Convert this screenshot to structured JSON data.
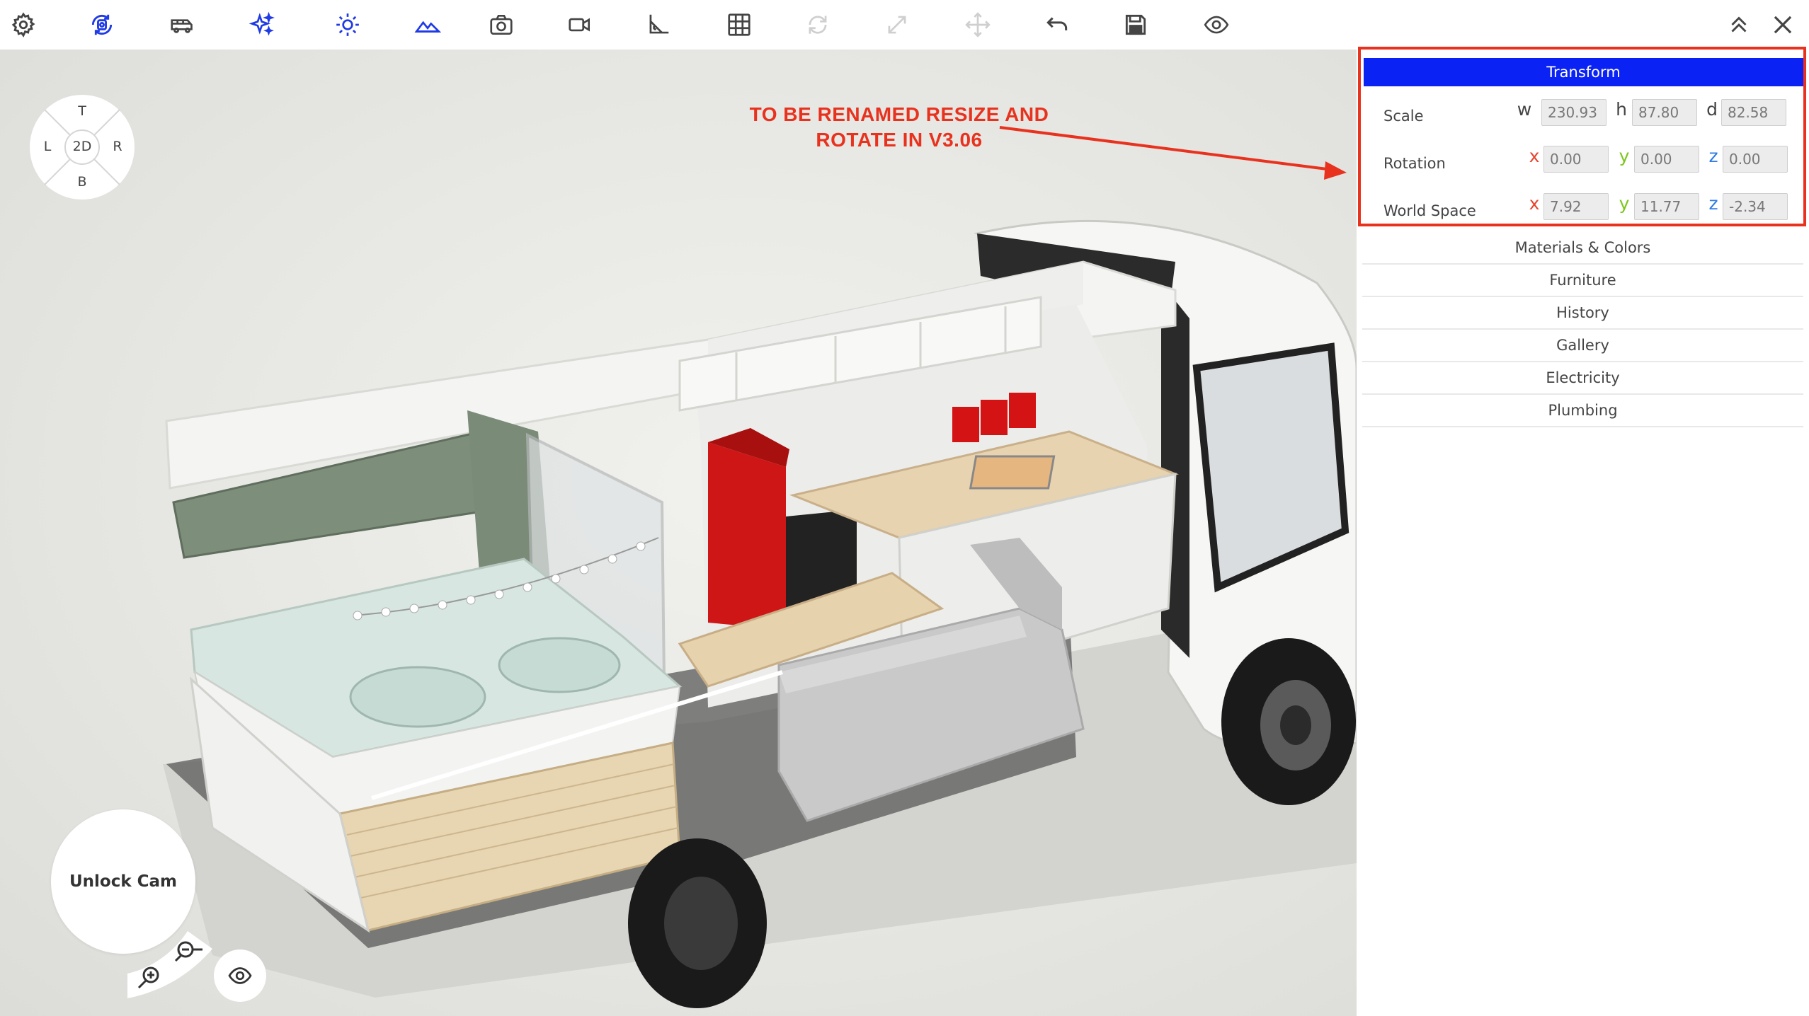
{
  "toolbar": {
    "icons": [
      "gear-icon",
      "rotate-view-icon",
      "van-icon",
      "sparkle-icon",
      "sun-icon",
      "terrain-icon",
      "camera-icon",
      "video-icon",
      "measure-icon",
      "grid-icon",
      "rotate-icon",
      "resize-icon",
      "move-icon",
      "undo-icon",
      "save-icon",
      "eye-icon",
      "collapse-icon",
      "close-icon"
    ]
  },
  "compass": {
    "top": "T",
    "left": "L",
    "center": "2D",
    "right": "R",
    "bottom": "B"
  },
  "annotation": {
    "line1": "TO BE RENAMED RESIZE AND",
    "line2": "ROTATE IN V3.06"
  },
  "camera": {
    "unlock_label": "Unlock Cam"
  },
  "panel": {
    "transform": {
      "title": "Transform",
      "scale": {
        "label": "Scale",
        "axes": [
          "w",
          "h",
          "d"
        ],
        "values": [
          "230.93",
          "87.80",
          "82.58"
        ]
      },
      "rotation": {
        "label": "Rotation",
        "axes": [
          "x",
          "y",
          "z"
        ],
        "values": [
          "0.00",
          "0.00",
          "0.00"
        ]
      },
      "world_space": {
        "label": "World Space",
        "axes": [
          "x",
          "y",
          "z"
        ],
        "values": [
          "7.92",
          "11.77",
          "-2.34"
        ]
      }
    },
    "sections": [
      "Materials & Colors",
      "Furniture",
      "History",
      "Gallery",
      "Electricity",
      "Plumbing"
    ]
  },
  "colors": {
    "accent_blue": "#0b22f5",
    "annotation_red": "#e8321e",
    "axis_x": "#e8432e",
    "axis_y": "#7cc61c",
    "axis_z": "#2f7ae5"
  }
}
